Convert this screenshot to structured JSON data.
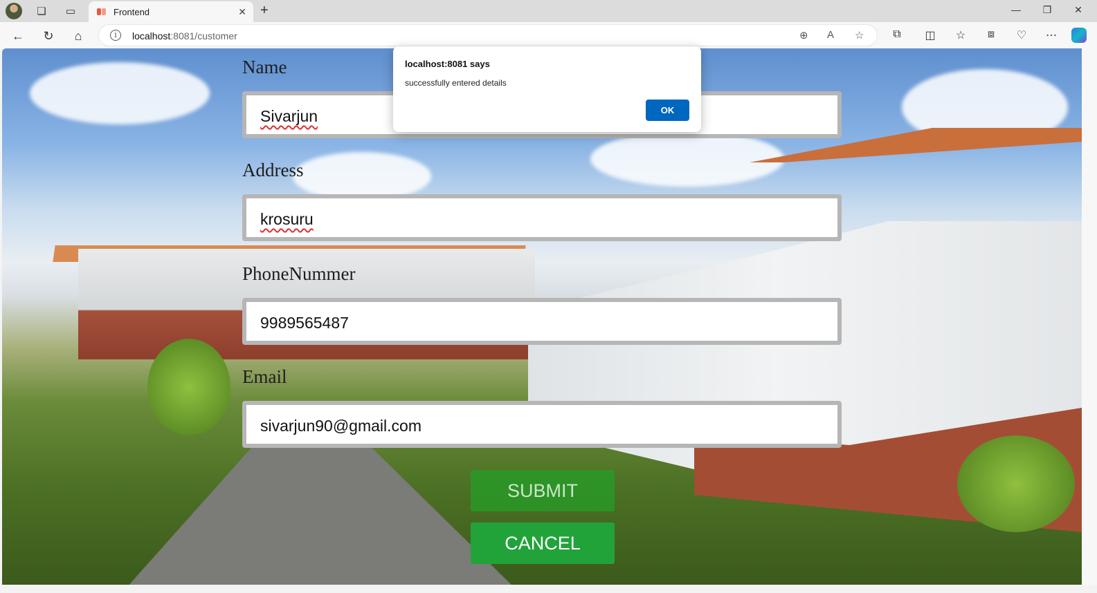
{
  "browser": {
    "tab_title": "Frontend",
    "tab_close": "✕",
    "new_tab": "+",
    "url_host": "localhost",
    "url_rest": ":8081/customer",
    "window_controls": {
      "minimize": "—",
      "restore": "❐",
      "close": "✕"
    }
  },
  "form": {
    "name_label": "Name",
    "name_value": "Sivarjun",
    "address_label": "Address",
    "address_value": "krosuru",
    "phone_label": "PhoneNummer",
    "phone_value": "9989565487",
    "email_label": "Email",
    "email_value": "sivarjun90@gmail.com",
    "submit_label": "SUBMIT",
    "cancel_label": "CANCEL"
  },
  "alert": {
    "title": "localhost:8081 says",
    "message": "successfully entered details",
    "ok_label": "OK"
  },
  "colors": {
    "dialog_ok": "#0067c0",
    "button_green": "#22a33a",
    "field_border": "#b6b6b6"
  }
}
